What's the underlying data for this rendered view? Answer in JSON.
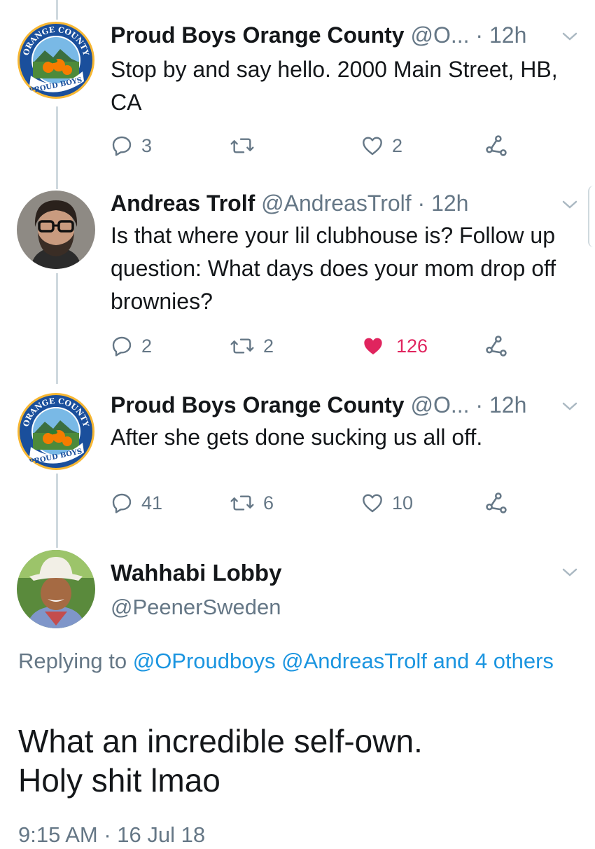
{
  "tweets": [
    {
      "name": "Proud Boys Orange County",
      "handle": "@O...",
      "time": "· 12h",
      "text": "Stop by and say hello. 2000 Main Street, HB, CA",
      "replies": "3",
      "retweets": "",
      "likes": "2",
      "avatar_badge_top": "ORANGE COUNTY",
      "avatar_badge_bottom": "PROUD BOYS"
    },
    {
      "name": "Andreas Trolf",
      "handle": "@AndreasTrolf",
      "time": "· 12h",
      "text": "Is that where your lil clubhouse is? Follow up question: What days does your mom drop off brownies?",
      "replies": "2",
      "retweets": "2",
      "likes": "126",
      "liked": true
    },
    {
      "name": "Proud Boys Orange County",
      "handle": "@O...",
      "time": "· 12h",
      "text": "After she gets done sucking us all off.",
      "replies": "41",
      "retweets": "6",
      "likes": "10",
      "avatar_badge_top": "ORANGE COUNTY",
      "avatar_badge_bottom": "PROUD BOYS"
    }
  ],
  "main_tweet": {
    "name": "Wahhabi Lobby",
    "handle": "@PeenerSweden",
    "replying_prefix": "Replying to",
    "replying_mention_1": "@OProudboys",
    "replying_mention_2": "@AndreasTrolf",
    "replying_others": "and 4 others",
    "text_line1": "What an incredible self-own.",
    "text_line2": "Holy shit lmao",
    "timestamp": "9:15 AM · 16 Jul 18"
  },
  "colors": {
    "text": "#14171a",
    "secondary": "#657786",
    "link": "#1b95e0",
    "like": "#e0245e",
    "thread_line": "#cfd9de"
  },
  "icons": {
    "reply": "speech-bubble",
    "retweet": "loop-arrows",
    "like": "heart",
    "share": "share-nodes",
    "more": "chevron-down"
  }
}
